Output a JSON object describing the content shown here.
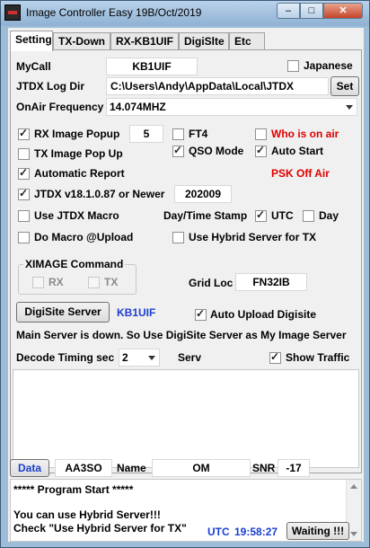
{
  "window": {
    "title": "Image Controller Easy 19B/Oct/2019",
    "min_glyph": "–",
    "max_glyph": "□",
    "close_glyph": "✕"
  },
  "tabs": [
    "Setting",
    "TX-Down",
    "RX-KB1UIF",
    "DigiSlte",
    "Etc"
  ],
  "setting": {
    "mycall_label": "MyCall",
    "mycall_value": "KB1UIF",
    "japanese_label": "Japanese",
    "japanese_checked": false,
    "jtdx_log_label": "JTDX Log Dir",
    "jtdx_log_value": "C:\\Users\\Andy\\AppData\\Local\\JTDX",
    "set_button": "Set",
    "onair_label": "OnAir Frequency",
    "onair_value": "14.074MHZ",
    "rx_popup_label": "RX Image Popup",
    "rx_popup_value": "5",
    "ft4_label": "FT4",
    "who_on_air_label": "Who is on air",
    "tx_popup_label": "TX Image Pop Up",
    "qso_mode_label": "QSO Mode",
    "auto_start_label": "Auto Start",
    "auto_report_label": "Automatic  Report",
    "psk_off_air": "PSK Off Air",
    "jtdx_version_label": "JTDX v18.1.0.87 or Newer",
    "jtdx_version_value": "202009",
    "use_jtdx_macro_label": "Use JTDX Macro",
    "daytime_stamp_label": "Day/Time Stamp",
    "utc_label": "UTC",
    "day_label": "Day",
    "do_macro_label": "Do Macro @Upload",
    "use_hybrid_label": "Use Hybrid Server for TX",
    "ximage_label": "XIMAGE Command",
    "rx_label": "RX",
    "tx_label": "TX",
    "gridloc_label": "Grid Loc",
    "gridloc_value": "FN32IB",
    "digisite_button": "DigiSite Server",
    "digisite_call": "KB1UIF",
    "auto_upload_label": "Auto Upload Digisite",
    "server_message": "Main Server is down. So Use DigiSite Server as My Image Server",
    "decode_timing_label": "Decode Timing sec",
    "decode_timing_value": "2",
    "serv_label": "Serv",
    "show_traffic_label": "Show Traffic"
  },
  "status": {
    "data_button": "Data",
    "call_value": "AA3SO",
    "name_label": "Name",
    "name_value": "OM",
    "snr_label": "SNR",
    "snr_value": "-17"
  },
  "log": {
    "line1": "***** Program Start *****",
    "line2": "You can use Hybrid Server!!!",
    "line3": "Check \"Use Hybrid Server for TX\"",
    "utc_label": "UTC",
    "time_value": "19:58:27",
    "waiting_button": "Waiting !!!"
  },
  "colors": {
    "accent_red": "#e00000",
    "accent_blue": "#1a3fd0",
    "title_bg": "#9dbcd8"
  }
}
